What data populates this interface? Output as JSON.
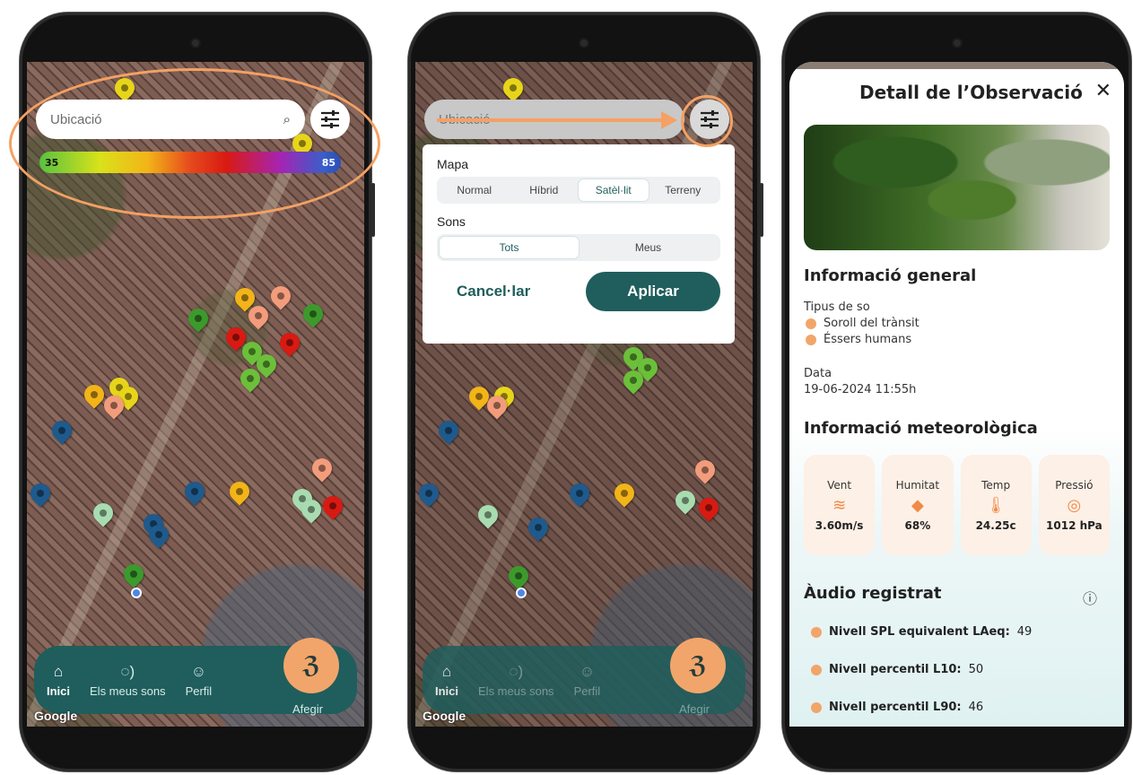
{
  "map_screen": {
    "search_placeholder": "Ubicació",
    "legend_min": "35",
    "legend_max": "85",
    "google_attr": "Google"
  },
  "nav": {
    "items": [
      {
        "label": "Inici",
        "icon": "home-icon"
      },
      {
        "label": "Els meus sons",
        "icon": "ear-wave-icon"
      },
      {
        "label": "Perfil",
        "icon": "profile-icon"
      }
    ],
    "add_label": "Afegir",
    "add_icon": "ear-plus-icon"
  },
  "filter_panel": {
    "map_label": "Mapa",
    "map_options": [
      "Normal",
      "Híbrid",
      "Satèl·lit",
      "Terreny"
    ],
    "map_selected": "Satèl·lit",
    "sounds_label": "Sons",
    "sound_options": [
      "Tots",
      "Meus"
    ],
    "sound_selected": "Tots",
    "cancel_label": "Cancel·lar",
    "apply_label": "Aplicar"
  },
  "detail": {
    "title": "Detall de l’Observació",
    "general_heading": "Informació general",
    "sound_type_label": "Tipus de so",
    "sound_types": [
      "Soroll del trànsit",
      "Éssers humans"
    ],
    "date_label": "Data",
    "date_value": "19-06-2024 11:55h",
    "weather_heading": "Informació meteorològica",
    "weather": [
      {
        "label": "Vent",
        "value": "3.60m/s",
        "icon": "wind-icon"
      },
      {
        "label": "Humitat",
        "value": "68%",
        "icon": "drop-icon"
      },
      {
        "label": "Temp",
        "value": "24.25c",
        "icon": "thermometer-icon"
      },
      {
        "label": "Pressió",
        "value": "1012 hPa",
        "icon": "gauge-icon"
      }
    ],
    "audio_heading": "Àudio registrat",
    "audio_rows": [
      {
        "label": "Nivell SPL equivalent LAeq:",
        "value": "49"
      },
      {
        "label": "Nivell percentil L10:",
        "value": "50"
      },
      {
        "label": "Nivell percentil L90:",
        "value": "46"
      }
    ]
  },
  "colors": {
    "teal": "#1f5e5c",
    "orange": "#f2a56a",
    "highlight": "#f4a163"
  }
}
